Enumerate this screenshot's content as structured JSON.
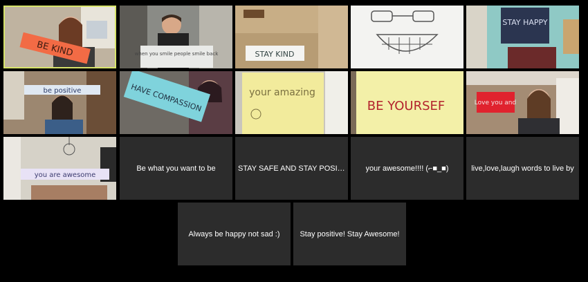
{
  "meeting": {
    "active_speaker_color": "#d7e36a",
    "tile_background": "#2c2c2c",
    "background": "#000000"
  },
  "video_tiles": [
    {
      "id": "v1",
      "sign": "BE KIND",
      "active": true
    },
    {
      "id": "v2",
      "sign": "when you smile people smile back"
    },
    {
      "id": "v3",
      "sign": "STAY KIND"
    },
    {
      "id": "v4",
      "sign": ""
    },
    {
      "id": "v5",
      "sign": "STAY HAPPY"
    },
    {
      "id": "v6",
      "sign": "be positive"
    },
    {
      "id": "v7",
      "sign": "HAVE COMPASSION"
    },
    {
      "id": "v8",
      "sign": "your amazing"
    },
    {
      "id": "v9",
      "sign": "BE YOURSEF"
    },
    {
      "id": "v10",
      "sign": "Love you and"
    },
    {
      "id": "v11",
      "sign": "you are awesome"
    }
  ],
  "name_tiles": [
    {
      "label": "Be what you want to be"
    },
    {
      "label": "STAY SAFE AND STAY POSITI..."
    },
    {
      "label": "your awesome!!!! (⌐■_■)"
    },
    {
      "label": "live,love,laugh words to live by"
    },
    {
      "label": "Always be happy not sad :)"
    },
    {
      "label": "Stay positive! Stay Awesome!"
    }
  ]
}
